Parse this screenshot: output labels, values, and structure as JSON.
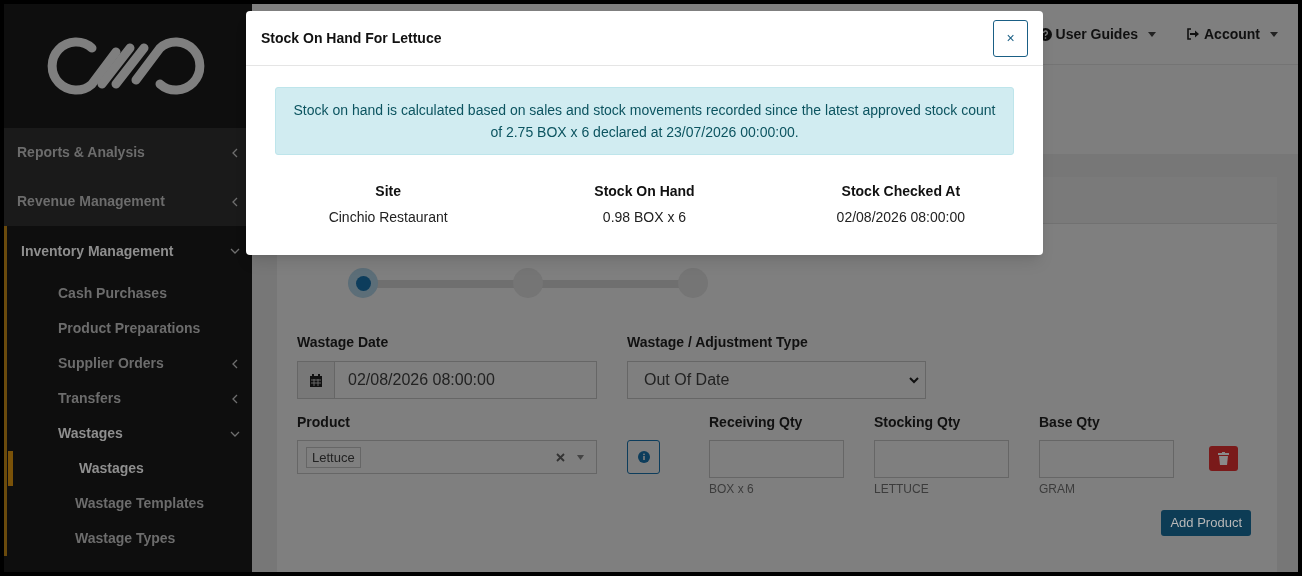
{
  "sidebar": {
    "items": [
      {
        "label": "Reports & Analysis",
        "expanded": false,
        "selected": false
      },
      {
        "label": "Revenue Management",
        "expanded": false,
        "selected": false
      },
      {
        "label": "Inventory Management",
        "expanded": true,
        "selected": false,
        "children": [
          {
            "label": "Cash Purchases",
            "selected": false
          },
          {
            "label": "Product Preparations",
            "selected": false
          },
          {
            "label": "Supplier Orders",
            "expanded": false,
            "selected": false
          },
          {
            "label": "Transfers",
            "expanded": false,
            "selected": false
          },
          {
            "label": "Wastages",
            "expanded": true,
            "selected": false,
            "children": [
              {
                "label": "Wastages",
                "selected": true
              },
              {
                "label": "Wastage Templates",
                "selected": false
              },
              {
                "label": "Wastage Types",
                "selected": false
              }
            ]
          }
        ]
      }
    ]
  },
  "topbar": {
    "menus": [
      {
        "label": "User Guides",
        "kind": "help"
      },
      {
        "label": "Account",
        "kind": "account"
      }
    ]
  },
  "stepper": {
    "steps": [
      {
        "selected": true
      },
      {
        "selected": false
      },
      {
        "selected": false
      }
    ]
  },
  "form": {
    "wastage_date": {
      "label": "Wastage Date",
      "value": "02/08/2026 08:00:00"
    },
    "type": {
      "label": "Wastage / Adjustment Type",
      "value": "Out Of Date"
    },
    "product": {
      "label": "Product",
      "tag": "Lettuce"
    },
    "quantities": [
      {
        "label": "Receiving Qty",
        "unit": "BOX x 6"
      },
      {
        "label": "Stocking Qty",
        "unit": "LETTUCE"
      },
      {
        "label": "Base Qty",
        "unit": "GRAM"
      }
    ],
    "add_button": "Add Product"
  },
  "modal": {
    "title": "Stock On Hand For Lettuce",
    "close": "×",
    "alert": "Stock on hand is calculated based on sales and stock movements recorded since the latest approved stock count of 2.75 BOX x 6 declared at 23/07/2026 00:00:00.",
    "columns": [
      {
        "heading": "Site",
        "value": "Cinchio Restaurant"
      },
      {
        "heading": "Stock On Hand",
        "value": "0.98 BOX x 6"
      },
      {
        "heading": "Stock Checked At",
        "value": "02/08/2026 08:00:00"
      }
    ]
  }
}
